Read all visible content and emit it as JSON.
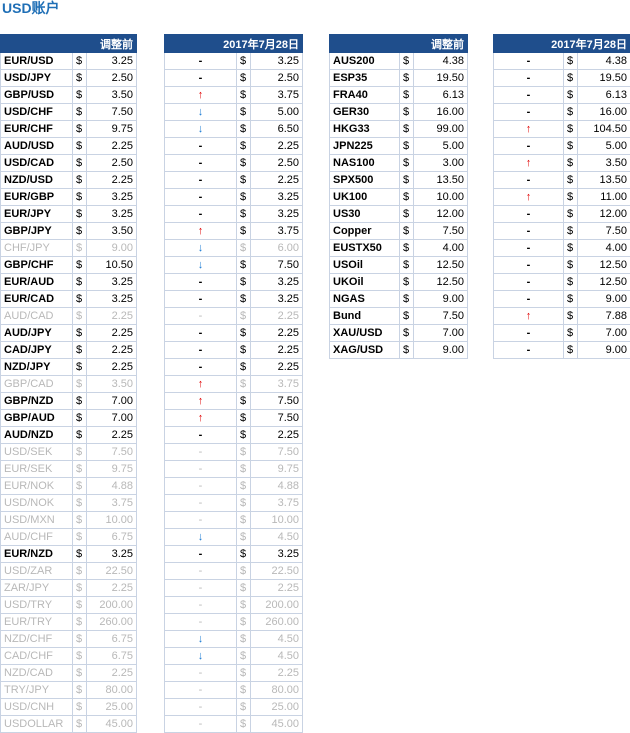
{
  "title": "USD账户",
  "headers": {
    "before": "调整前",
    "date": "2017年7月28日"
  },
  "currency_symbol": "$",
  "fx_rows": [
    {
      "sym": "EUR/USD",
      "before": "3.25",
      "change": "-",
      "after": "3.25",
      "active": true
    },
    {
      "sym": "USD/JPY",
      "before": "2.50",
      "change": "-",
      "after": "2.50",
      "active": true
    },
    {
      "sym": "GBP/USD",
      "before": "3.50",
      "change": "up",
      "after": "3.75",
      "active": true
    },
    {
      "sym": "USD/CHF",
      "before": "7.50",
      "change": "down",
      "after": "5.00",
      "active": true
    },
    {
      "sym": "EUR/CHF",
      "before": "9.75",
      "change": "down",
      "after": "6.50",
      "active": true
    },
    {
      "sym": "AUD/USD",
      "before": "2.25",
      "change": "-",
      "after": "2.25",
      "active": true
    },
    {
      "sym": "USD/CAD",
      "before": "2.50",
      "change": "-",
      "after": "2.50",
      "active": true
    },
    {
      "sym": "NZD/USD",
      "before": "2.25",
      "change": "-",
      "after": "2.25",
      "active": true
    },
    {
      "sym": "EUR/GBP",
      "before": "3.25",
      "change": "-",
      "after": "3.25",
      "active": true
    },
    {
      "sym": "EUR/JPY",
      "before": "3.25",
      "change": "-",
      "after": "3.25",
      "active": true
    },
    {
      "sym": "GBP/JPY",
      "before": "3.50",
      "change": "up",
      "after": "3.75",
      "active": true
    },
    {
      "sym": "CHF/JPY",
      "before": "9.00",
      "change": "down",
      "after": "6.00",
      "active": false
    },
    {
      "sym": "GBP/CHF",
      "before": "10.50",
      "change": "down",
      "after": "7.50",
      "active": true
    },
    {
      "sym": "EUR/AUD",
      "before": "3.25",
      "change": "-",
      "after": "3.25",
      "active": true
    },
    {
      "sym": "EUR/CAD",
      "before": "3.25",
      "change": "-",
      "after": "3.25",
      "active": true
    },
    {
      "sym": "AUD/CAD",
      "before": "2.25",
      "change": "-",
      "after": "2.25",
      "active": false
    },
    {
      "sym": "AUD/JPY",
      "before": "2.25",
      "change": "-",
      "after": "2.25",
      "active": true
    },
    {
      "sym": "CAD/JPY",
      "before": "2.25",
      "change": "-",
      "after": "2.25",
      "active": true
    },
    {
      "sym": "NZD/JPY",
      "before": "2.25",
      "change": "-",
      "after": "2.25",
      "active": true
    },
    {
      "sym": "GBP/CAD",
      "before": "3.50",
      "change": "up",
      "after": "3.75",
      "active": false
    },
    {
      "sym": "GBP/NZD",
      "before": "7.00",
      "change": "up",
      "after": "7.50",
      "active": true
    },
    {
      "sym": "GBP/AUD",
      "before": "7.00",
      "change": "up",
      "after": "7.50",
      "active": true
    },
    {
      "sym": "AUD/NZD",
      "before": "2.25",
      "change": "-",
      "after": "2.25",
      "active": true
    },
    {
      "sym": "USD/SEK",
      "before": "7.50",
      "change": "-",
      "after": "7.50",
      "active": false
    },
    {
      "sym": "EUR/SEK",
      "before": "9.75",
      "change": "-",
      "after": "9.75",
      "active": false
    },
    {
      "sym": "EUR/NOK",
      "before": "4.88",
      "change": "-",
      "after": "4.88",
      "active": false
    },
    {
      "sym": "USD/NOK",
      "before": "3.75",
      "change": "-",
      "after": "3.75",
      "active": false
    },
    {
      "sym": "USD/MXN",
      "before": "10.00",
      "change": "-",
      "after": "10.00",
      "active": false
    },
    {
      "sym": "AUD/CHF",
      "before": "6.75",
      "change": "down",
      "after": "4.50",
      "active": false
    },
    {
      "sym": "EUR/NZD",
      "before": "3.25",
      "change": "-",
      "after": "3.25",
      "active": true
    },
    {
      "sym": "USD/ZAR",
      "before": "22.50",
      "change": "-",
      "after": "22.50",
      "active": false
    },
    {
      "sym": "ZAR/JPY",
      "before": "2.25",
      "change": "-",
      "after": "2.25",
      "active": false
    },
    {
      "sym": "USD/TRY",
      "before": "200.00",
      "change": "-",
      "after": "200.00",
      "active": false
    },
    {
      "sym": "EUR/TRY",
      "before": "260.00",
      "change": "-",
      "after": "260.00",
      "active": false
    },
    {
      "sym": "NZD/CHF",
      "before": "6.75",
      "change": "down",
      "after": "4.50",
      "active": false
    },
    {
      "sym": "CAD/CHF",
      "before": "6.75",
      "change": "down",
      "after": "4.50",
      "active": false
    },
    {
      "sym": "NZD/CAD",
      "before": "2.25",
      "change": "-",
      "after": "2.25",
      "active": false
    },
    {
      "sym": "TRY/JPY",
      "before": "80.00",
      "change": "-",
      "after": "80.00",
      "active": false
    },
    {
      "sym": "USD/CNH",
      "before": "25.00",
      "change": "-",
      "after": "25.00",
      "active": false
    },
    {
      "sym": "USDOLLAR",
      "before": "45.00",
      "change": "-",
      "after": "45.00",
      "active": false
    }
  ],
  "cfd_rows": [
    {
      "sym": "AUS200",
      "before": "4.38",
      "change": "-",
      "after": "4.38",
      "active": true
    },
    {
      "sym": "ESP35",
      "before": "19.50",
      "change": "-",
      "after": "19.50",
      "active": true
    },
    {
      "sym": "FRA40",
      "before": "6.13",
      "change": "-",
      "after": "6.13",
      "active": true
    },
    {
      "sym": "GER30",
      "before": "16.00",
      "change": "-",
      "after": "16.00",
      "active": true
    },
    {
      "sym": "HKG33",
      "before": "99.00",
      "change": "up",
      "after": "104.50",
      "active": true
    },
    {
      "sym": "JPN225",
      "before": "5.00",
      "change": "-",
      "after": "5.00",
      "active": true
    },
    {
      "sym": "NAS100",
      "before": "3.00",
      "change": "up",
      "after": "3.50",
      "active": true
    },
    {
      "sym": "SPX500",
      "before": "13.50",
      "change": "-",
      "after": "13.50",
      "active": true
    },
    {
      "sym": "UK100",
      "before": "10.00",
      "change": "up",
      "after": "11.00",
      "active": true
    },
    {
      "sym": "US30",
      "before": "12.00",
      "change": "-",
      "after": "12.00",
      "active": true
    },
    {
      "sym": "Copper",
      "before": "7.50",
      "change": "-",
      "after": "7.50",
      "active": true
    },
    {
      "sym": "EUSTX50",
      "before": "4.00",
      "change": "-",
      "after": "4.00",
      "active": true
    },
    {
      "sym": "USOil",
      "before": "12.50",
      "change": "-",
      "after": "12.50",
      "active": true
    },
    {
      "sym": "UKOil",
      "before": "12.50",
      "change": "-",
      "after": "12.50",
      "active": true
    },
    {
      "sym": "NGAS",
      "before": "9.00",
      "change": "-",
      "after": "9.00",
      "active": true
    },
    {
      "sym": "Bund",
      "before": "7.50",
      "change": "up",
      "after": "7.88",
      "active": true
    },
    {
      "sym": "XAU/USD",
      "before": "7.00",
      "change": "-",
      "after": "7.00",
      "active": true
    },
    {
      "sym": "XAG/USD",
      "before": "9.00",
      "change": "-",
      "after": "9.00",
      "active": true
    }
  ],
  "glyphs": {
    "up": "↑",
    "down": "↓",
    "none": "-"
  },
  "colors": {
    "header_bg": "#1f4e8c",
    "up": "#e00000",
    "down": "#1a7ad4",
    "dim": "#b8b8b8",
    "title": "#1f6fb6"
  }
}
